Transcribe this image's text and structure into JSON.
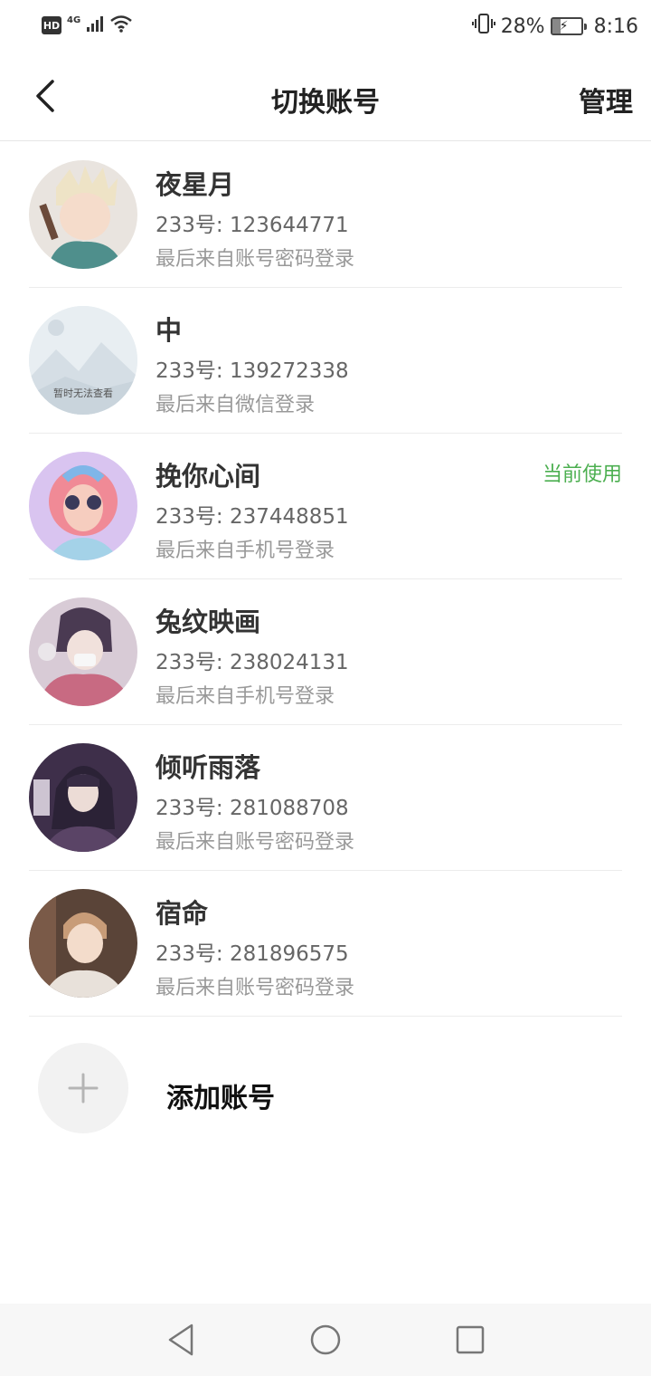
{
  "status_bar": {
    "hd": "HD",
    "network": "4G",
    "battery_percent": "28%",
    "battery_level": 0.28,
    "time": "8:16",
    "icons": [
      "signal-icon",
      "wifi-icon",
      "vibrate-icon",
      "battery-icon"
    ]
  },
  "header": {
    "title": "切换账号",
    "manage_label": "管理",
    "back_icon": "chevron-left-icon"
  },
  "accounts": [
    {
      "name": "夜星月",
      "id_line": "233号: 123644771",
      "login": "最后来自账号密码登录",
      "current": ""
    },
    {
      "name": "中",
      "id_line": "233号: 139272338",
      "login": "最后来自微信登录",
      "current": "",
      "avatar_placeholder": "暂时无法查看"
    },
    {
      "name": "挽你心间",
      "id_line": "233号: 237448851",
      "login": "最后来自手机号登录",
      "current": "当前使用"
    },
    {
      "name": "兔纹映画",
      "id_line": "233号: 238024131",
      "login": "最后来自手机号登录",
      "current": ""
    },
    {
      "name": "倾听雨落",
      "id_line": "233号: 281088708",
      "login": "最后来自账号密码登录",
      "current": ""
    },
    {
      "name": "宿命",
      "id_line": "233号: 281896575",
      "login": "最后来自账号密码登录",
      "current": ""
    }
  ],
  "add_account": {
    "label": "添加账号",
    "icon": "plus-icon"
  },
  "nav_bar": {
    "icons": [
      "back-triangle-icon",
      "home-circle-icon",
      "recents-square-icon"
    ]
  },
  "colors": {
    "current_badge": "#4caf50",
    "text_primary": "#333333",
    "text_secondary": "#666666",
    "text_tertiary": "#999999"
  }
}
